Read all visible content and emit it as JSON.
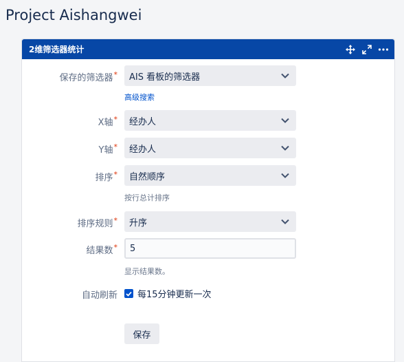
{
  "page": {
    "title": "Project Aishangwei"
  },
  "gadget": {
    "title": "2维筛选器统计",
    "icons": [
      "move-icon",
      "expand-icon",
      "more-icon"
    ]
  },
  "form": {
    "saved_filter": {
      "label": "保存的筛选器",
      "value": "AIS 看板的筛选器",
      "link": "高级搜索"
    },
    "x_axis": {
      "label": "X轴",
      "value": "经办人"
    },
    "y_axis": {
      "label": "Y轴",
      "value": "经办人"
    },
    "sort": {
      "label": "排序",
      "value": "自然顺序",
      "help": "按行总计排序"
    },
    "sort_rule": {
      "label": "排序规则",
      "value": "升序"
    },
    "result_count": {
      "label": "结果数",
      "value": "5",
      "help": "显示结果数。"
    },
    "auto_refresh": {
      "label": "自动刷新",
      "option": "每15分钟更新一次",
      "checked": true
    },
    "save_label": "保存"
  },
  "colors": {
    "header": "#0747a6",
    "link": "#0052cc",
    "required": "#de350b",
    "checkbox": "#0052cc"
  }
}
